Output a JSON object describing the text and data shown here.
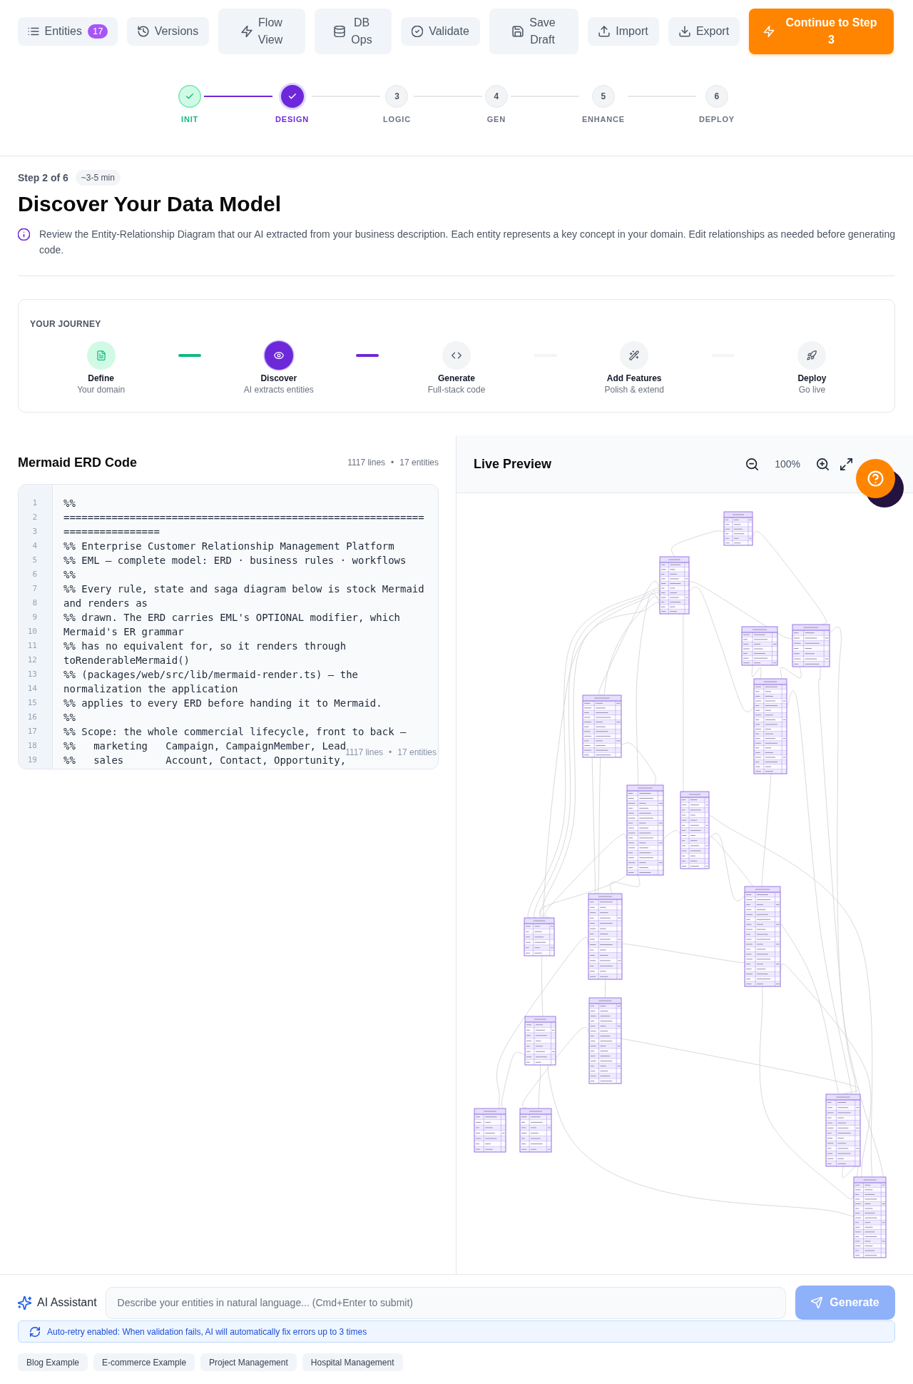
{
  "toolbar": {
    "buttons": [
      {
        "label": "Entities",
        "badge": "17"
      },
      {
        "label": "Versions"
      },
      {
        "label": "Flow View"
      },
      {
        "label": "DB Ops"
      },
      {
        "label": "Validate"
      },
      {
        "label": "Save Draft"
      },
      {
        "label": "Import"
      },
      {
        "label": "Export"
      }
    ],
    "continue_button": {
      "label": "Continue to Step 3"
    }
  },
  "stepper": {
    "steps": [
      {
        "label": "INIT",
        "done": true,
        "current": false
      },
      {
        "label": "DESIGN",
        "done": false,
        "current": true
      },
      {
        "label": "LOGIC",
        "number": "3",
        "done": false,
        "current": false
      },
      {
        "label": "GEN",
        "number": "4",
        "done": false,
        "current": false
      },
      {
        "label": "ENHANCE",
        "number": "5",
        "done": false,
        "current": false
      },
      {
        "label": "DEPLOY",
        "number": "6",
        "done": false,
        "current": false
      }
    ]
  },
  "step_header": {
    "step_label": "Step 2 of 6",
    "duration": "~3-5 min",
    "title": "Discover Your Data Model",
    "description": "Review the Entity-Relationship Diagram that our AI extracted from your business description. Each entity represents a key concept in your domain. Edit relationships as needed before generating code."
  },
  "journey": {
    "title": "YOUR JOURNEY",
    "steps": [
      {
        "title": "Define",
        "subtitle": "Your domain",
        "done": true,
        "current": false
      },
      {
        "title": "Discover",
        "subtitle": "AI extracts entities",
        "done": false,
        "current": true
      },
      {
        "title": "Generate",
        "subtitle": "Full-stack code",
        "done": false,
        "current": false
      },
      {
        "title": "Add Features",
        "subtitle": "Polish & extend",
        "done": false,
        "current": false
      },
      {
        "title": "Deploy",
        "subtitle": "Go live",
        "done": false,
        "current": false
      }
    ]
  },
  "code_panel": {
    "title": "Mermaid ERD Code",
    "stats": {
      "lines": "1117 lines",
      "separator": "•",
      "entities": "17 entities"
    },
    "code_lines": [
      {
        "number": "1",
        "text": "%%"
      },
      {
        "number": "2",
        "text": "============================================================"
      },
      {
        "number": "3",
        "text": "================"
      },
      {
        "number": "4",
        "text": "%% Enterprise Customer Relationship Management Platform"
      },
      {
        "number": "5",
        "text": "%% EML — complete model: ERD · business rules · workflows"
      },
      {
        "number": "6",
        "text": "%%"
      },
      {
        "number": "7",
        "text": "%% Every rule, state and saga diagram below is stock Mermaid"
      },
      {
        "number": "8",
        "text": "and renders as"
      },
      {
        "number": "9",
        "text": "%% drawn. The ERD carries EML's OPTIONAL modifier, which"
      },
      {
        "number": "10",
        "text": "Mermaid's ER grammar"
      },
      {
        "number": "11",
        "text": "%% has no equivalent for, so it renders through"
      },
      {
        "number": "12",
        "text": "toRenderableMermaid()"
      },
      {
        "number": "13",
        "text": "%% (packages/web/src/lib/mermaid-render.ts) — the"
      },
      {
        "number": "14",
        "text": "normalization the application"
      },
      {
        "number": "15",
        "text": "%% applies to every ERD before handing it to Mermaid."
      },
      {
        "number": "16",
        "text": "%%"
      },
      {
        "number": "17",
        "text": "%% Scope: the whole commercial lifecycle, front to back —"
      },
      {
        "number": "18",
        "text": "%%   marketing   Campaign, CampaignMember, Lead"
      },
      {
        "number": "19",
        "text": "%%   sales       Account, Contact, Opportunity,"
      }
    ],
    "overlay_stats": {
      "lines": "1117 lines",
      "separator": "•",
      "entities": "17 entities"
    }
  },
  "preview": {
    "title": "Live Preview",
    "zoom_level": "100%"
  },
  "assistant": {
    "label": "AI Assistant",
    "input": {
      "placeholder": "Describe your entities in natural language... (Cmd+Enter to submit)"
    },
    "generate_button": {
      "label": "Generate",
      "disabled": true
    },
    "notice": "Auto-retry enabled: When validation fails, AI will automatically fix errors up to 3 times",
    "examples": [
      "Blog Example",
      "E-commerce Example",
      "Project Management",
      "Hospital Management"
    ]
  }
}
